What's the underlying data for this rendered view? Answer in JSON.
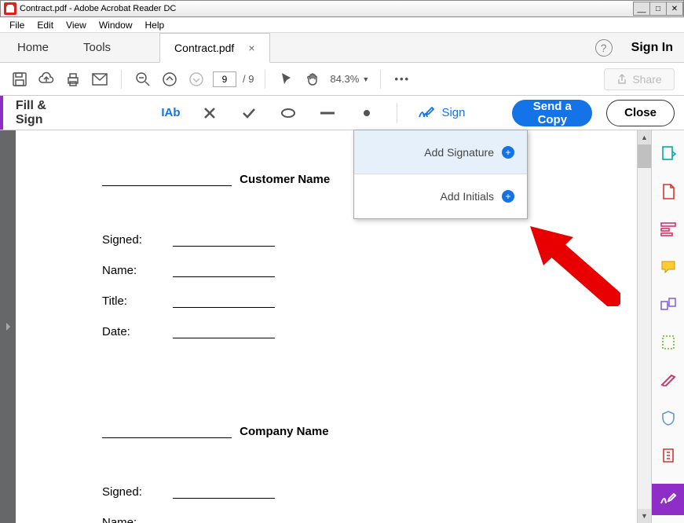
{
  "title": "Contract.pdf - Adobe Acrobat Reader DC",
  "menu": {
    "file": "File",
    "edit": "Edit",
    "view": "View",
    "window": "Window",
    "help": "Help"
  },
  "tabs": {
    "home": "Home",
    "tools": "Tools",
    "doc": "Contract.pdf",
    "signin": "Sign In"
  },
  "toolbar": {
    "page": "9",
    "pages": "/ 9",
    "zoom": "84.3%",
    "share": "Share"
  },
  "fillsign": {
    "label": "Fill & Sign",
    "sign": "Sign",
    "send": "Send a Copy",
    "close": "Close"
  },
  "signmenu": {
    "addSig": "Add Signature",
    "addInit": "Add Initials"
  },
  "doc": {
    "customerName": "Customer Name",
    "signed": "Signed:",
    "name": "Name:",
    "title": "Title:",
    "date": "Date:",
    "companyName": "Company Name"
  }
}
